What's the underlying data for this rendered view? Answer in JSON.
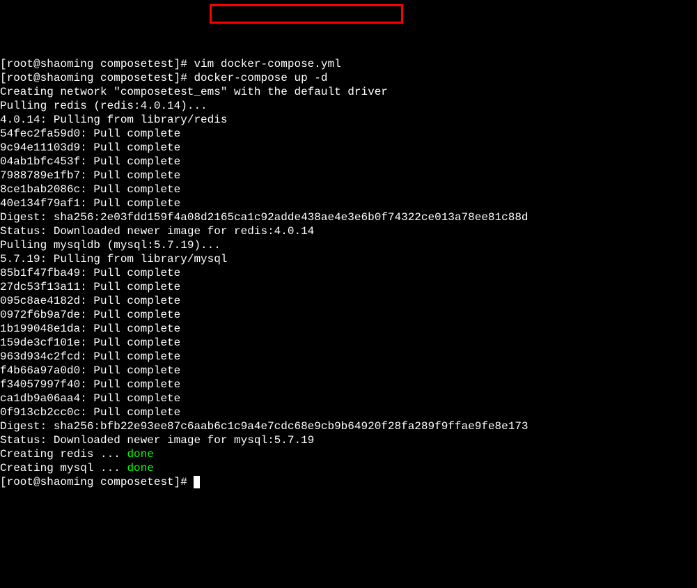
{
  "terminal": {
    "prompt_user": "root",
    "prompt_host": "shaoming",
    "prompt_dir": "composetest",
    "lines": [
      {
        "type": "prompt_cmd",
        "prompt": "[root@shaoming composetest]# ",
        "cmd": "vim docker-compose.yml"
      },
      {
        "type": "prompt_cmd",
        "prompt": "[root@shaoming composetest]# ",
        "cmd": "docker-compose up -d"
      },
      {
        "type": "output",
        "text": "Creating network \"composetest_ems\" with the default driver"
      },
      {
        "type": "output",
        "text": "Pulling redis (redis:4.0.14)..."
      },
      {
        "type": "output",
        "text": "4.0.14: Pulling from library/redis"
      },
      {
        "type": "output",
        "text": "54fec2fa59d0: Pull complete"
      },
      {
        "type": "output",
        "text": "9c94e11103d9: Pull complete"
      },
      {
        "type": "output",
        "text": "04ab1bfc453f: Pull complete"
      },
      {
        "type": "output",
        "text": "7988789e1fb7: Pull complete"
      },
      {
        "type": "output",
        "text": "8ce1bab2086c: Pull complete"
      },
      {
        "type": "output",
        "text": "40e134f79af1: Pull complete"
      },
      {
        "type": "output",
        "text": "Digest: sha256:2e03fdd159f4a08d2165ca1c92adde438ae4e3e6b0f74322ce013a78ee81c88d"
      },
      {
        "type": "output",
        "text": "Status: Downloaded newer image for redis:4.0.14"
      },
      {
        "type": "output",
        "text": "Pulling mysqldb (mysql:5.7.19)..."
      },
      {
        "type": "output",
        "text": "5.7.19: Pulling from library/mysql"
      },
      {
        "type": "output",
        "text": "85b1f47fba49: Pull complete"
      },
      {
        "type": "output",
        "text": "27dc53f13a11: Pull complete"
      },
      {
        "type": "output",
        "text": "095c8ae4182d: Pull complete"
      },
      {
        "type": "output",
        "text": "0972f6b9a7de: Pull complete"
      },
      {
        "type": "output",
        "text": "1b199048e1da: Pull complete"
      },
      {
        "type": "output",
        "text": "159de3cf101e: Pull complete"
      },
      {
        "type": "output",
        "text": "963d934c2fcd: Pull complete"
      },
      {
        "type": "output",
        "text": "f4b66a97a0d0: Pull complete"
      },
      {
        "type": "output",
        "text": "f34057997f40: Pull complete"
      },
      {
        "type": "output",
        "text": "ca1db9a06aa4: Pull complete"
      },
      {
        "type": "output",
        "text": "0f913cb2cc0c: Pull complete"
      },
      {
        "type": "output",
        "text": "Digest: sha256:bfb22e93ee87c6aab6c1c9a4e7cdc68e9cb9b64920f28fa289f9ffae9fe8e173"
      },
      {
        "type": "output",
        "text": "Status: Downloaded newer image for mysql:5.7.19"
      },
      {
        "type": "creating",
        "text1": "Creating redis ... ",
        "text2": "done"
      },
      {
        "type": "creating",
        "text1": "Creating mysql ... ",
        "text2": "done"
      },
      {
        "type": "prompt_cursor",
        "prompt": "[root@shaoming composetest]# "
      }
    ]
  },
  "highlight": {
    "target": "docker-compose up -d"
  }
}
